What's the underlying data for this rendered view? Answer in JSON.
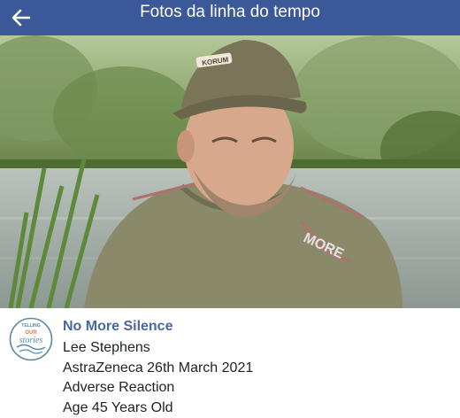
{
  "header": {
    "title": "Fotos da linha do tempo",
    "back_icon": "arrow-left-icon",
    "background": "#3b5998"
  },
  "photo": {
    "description_icon": "photo-of-man-in-cap-by-lake",
    "cap_logo": "KORUM",
    "shirt_text": "MORE"
  },
  "post": {
    "page_name": "No More Silence",
    "avatar_text": [
      "TELLING",
      "OUR",
      "stories"
    ],
    "caption_lines": [
      "Lee Stephens",
      "AstraZeneca 26th March 2021",
      "Adverse Reaction",
      "Age 45 Years Old"
    ],
    "link_color": "#4b67a1"
  }
}
